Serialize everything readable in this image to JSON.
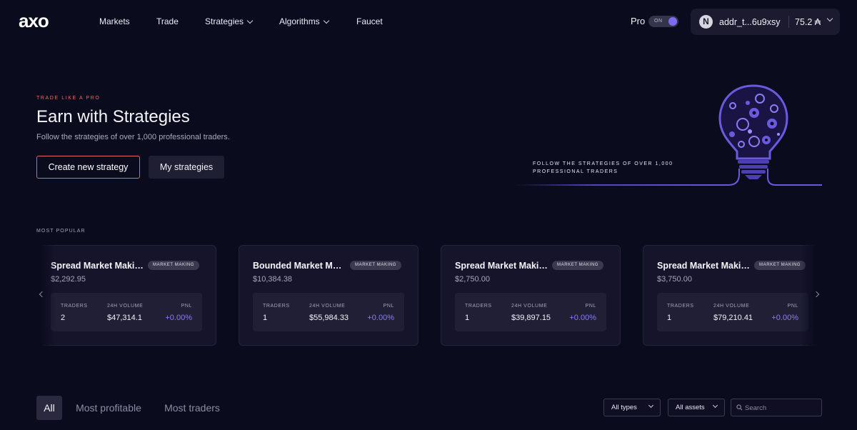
{
  "brand": {
    "logo": "axo"
  },
  "nav": {
    "links": [
      "Markets",
      "Trade",
      "Strategies",
      "Algorithms",
      "Faucet"
    ],
    "pro_label": "Pro",
    "pro_toggle": "ON",
    "wallet_address": "addr_t...6u9xsy",
    "wallet_balance": "75.2 ₳"
  },
  "hero": {
    "eyebrow": "TRADE LIKE A PRO",
    "title": "Earn with Strategies",
    "subtitle": "Follow the strategies of over 1,000 professional traders.",
    "primary_button": "Create new strategy",
    "secondary_button": "My strategies",
    "art_caption_line1": "FOLLOW THE STRATEGIES OF OVER 1,000",
    "art_caption_line2": "PROFESSIONAL TRADERS"
  },
  "popular": {
    "label": "MOST POPULAR",
    "stat_labels": {
      "traders": "TRADERS",
      "volume": "24H VOLUME",
      "pnl": "PNL"
    },
    "cards": [
      {
        "title": "Spread Market Making",
        "badge": "MARKET MAKING",
        "price": "$2,292.95",
        "traders": "2",
        "volume": "$47,314.1",
        "pnl": "+0.00%"
      },
      {
        "title": "Bounded Market Making",
        "badge": "MARKET MAKING",
        "price": "$10,384.38",
        "traders": "1",
        "volume": "$55,984.33",
        "pnl": "+0.00%"
      },
      {
        "title": "Spread Market Making",
        "badge": "MARKET MAKING",
        "price": "$2,750.00",
        "traders": "1",
        "volume": "$39,897.15",
        "pnl": "+0.00%"
      },
      {
        "title": "Spread Market Making",
        "badge": "MARKET MAKING",
        "price": "$3,750.00",
        "traders": "1",
        "volume": "$79,210.41",
        "pnl": "+0.00%"
      }
    ]
  },
  "filters": {
    "tabs": [
      "All",
      "Most profitable",
      "Most traders"
    ],
    "active_tab": "All",
    "type_select": "All types",
    "asset_select": "All assets",
    "search_placeholder": "Search"
  },
  "colors": {
    "accent": "#7b6cf0",
    "pnl": "#8a7cf5",
    "highlight": "#e86a5c",
    "background": "#0b0b1e"
  }
}
